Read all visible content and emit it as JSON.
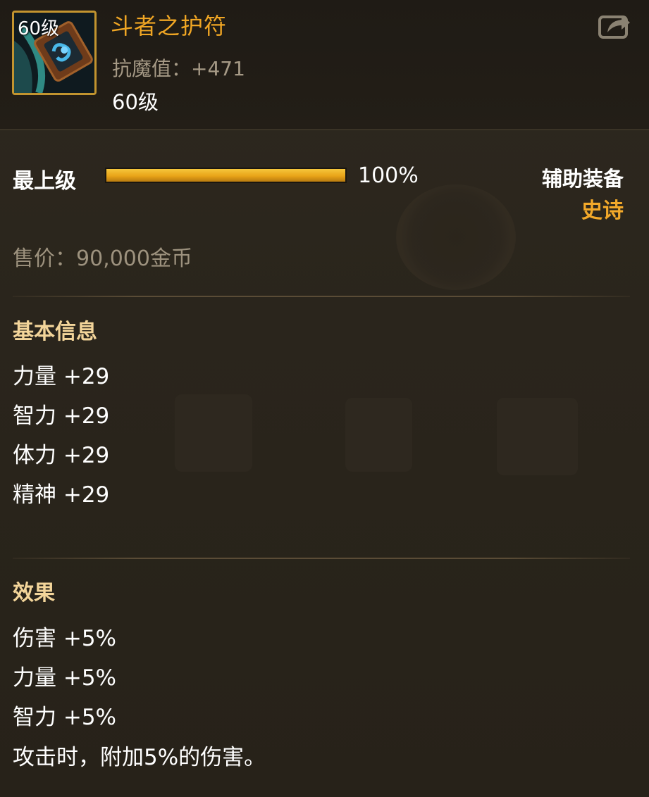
{
  "item": {
    "icon": "amulet-icon",
    "level_badge": "60级",
    "name": "斗者之护符",
    "stat": "抗魔值：+471",
    "required_level": "60级"
  },
  "quality": {
    "label": "最上级",
    "progress": 1.0,
    "progress_text": "100%"
  },
  "type": "辅助装备",
  "rarity": "史诗",
  "price": "售价：90,000金币",
  "basic_info": {
    "title": "基本信息",
    "stats": [
      "力量 +29",
      "智力 +29",
      "体力 +29",
      "精神 +29"
    ]
  },
  "effects": {
    "title": "效果",
    "lines": [
      "伤害 +5%",
      "力量 +5%",
      "智力 +5%",
      "攻击时，附加5%的伤害。"
    ]
  },
  "colors": {
    "name": "#f0a624",
    "rarity": "#f3a92a",
    "section_title": "#f3d59a",
    "bar": "#e9a418"
  }
}
